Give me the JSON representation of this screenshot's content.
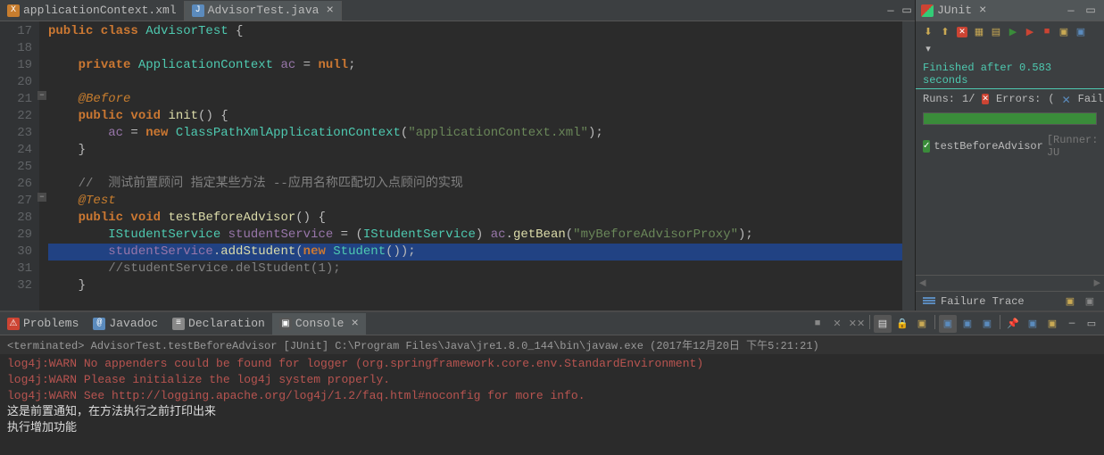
{
  "editor": {
    "tabs": [
      {
        "label": "applicationContext.xml",
        "type": "x"
      },
      {
        "label": "AdvisorTest.java",
        "type": "j"
      }
    ],
    "activeTab": 1,
    "lines": [
      {
        "n": "17",
        "t": [
          {
            "c": "kw",
            "v": "public class "
          },
          {
            "c": "clsname",
            "v": "AdvisorTest"
          },
          {
            "c": "",
            "v": " {"
          }
        ]
      },
      {
        "n": "18",
        "t": []
      },
      {
        "n": "19",
        "t": [
          {
            "c": "",
            "v": "    "
          },
          {
            "c": "kw",
            "v": "private "
          },
          {
            "c": "clsname",
            "v": "ApplicationContext"
          },
          {
            "c": "",
            "v": " "
          },
          {
            "c": "fld",
            "v": "ac"
          },
          {
            "c": "",
            "v": " = "
          },
          {
            "c": "kw",
            "v": "null"
          },
          {
            "c": "",
            "v": ";"
          }
        ]
      },
      {
        "n": "20",
        "t": []
      },
      {
        "n": "21",
        "fold": true,
        "t": [
          {
            "c": "",
            "v": "    "
          },
          {
            "c": "anno",
            "v": "@Before"
          }
        ]
      },
      {
        "n": "22",
        "t": [
          {
            "c": "",
            "v": "    "
          },
          {
            "c": "kw",
            "v": "public void "
          },
          {
            "c": "fn",
            "v": "init"
          },
          {
            "c": "",
            "v": "() {"
          }
        ]
      },
      {
        "n": "23",
        "t": [
          {
            "c": "",
            "v": "        "
          },
          {
            "c": "fld",
            "v": "ac"
          },
          {
            "c": "",
            "v": " = "
          },
          {
            "c": "kw",
            "v": "new "
          },
          {
            "c": "clsname",
            "v": "ClassPathXmlApplicationContext"
          },
          {
            "c": "",
            "v": "("
          },
          {
            "c": "str",
            "v": "\"applicationContext.xml\""
          },
          {
            "c": "",
            "v": ");"
          }
        ]
      },
      {
        "n": "24",
        "t": [
          {
            "c": "",
            "v": "    }"
          }
        ]
      },
      {
        "n": "25",
        "t": []
      },
      {
        "n": "26",
        "t": [
          {
            "c": "",
            "v": "    "
          },
          {
            "c": "cmt",
            "v": "//  测试前置顾问 指定某些方法 --应用名称匹配切入点顾问的实现"
          }
        ]
      },
      {
        "n": "27",
        "fold": true,
        "t": [
          {
            "c": "",
            "v": "    "
          },
          {
            "c": "anno",
            "v": "@Test"
          }
        ]
      },
      {
        "n": "28",
        "t": [
          {
            "c": "",
            "v": "    "
          },
          {
            "c": "kw",
            "v": "public void "
          },
          {
            "c": "fn",
            "v": "testBeforeAdvisor"
          },
          {
            "c": "",
            "v": "() {"
          }
        ]
      },
      {
        "n": "29",
        "t": [
          {
            "c": "",
            "v": "        "
          },
          {
            "c": "clsname",
            "v": "IStudentService"
          },
          {
            "c": "",
            "v": " "
          },
          {
            "c": "fld",
            "v": "studentService"
          },
          {
            "c": "",
            "v": " = ("
          },
          {
            "c": "clsname",
            "v": "IStudentService"
          },
          {
            "c": "",
            "v": ") "
          },
          {
            "c": "fld",
            "v": "ac"
          },
          {
            "c": "",
            "v": "."
          },
          {
            "c": "fn",
            "v": "getBean"
          },
          {
            "c": "",
            "v": "("
          },
          {
            "c": "str",
            "v": "\"myBeforeAdvisorProxy\""
          },
          {
            "c": "",
            "v": ");"
          }
        ]
      },
      {
        "n": "30",
        "hl": true,
        "t": [
          {
            "c": "",
            "v": "        "
          },
          {
            "c": "fld",
            "v": "studentService"
          },
          {
            "c": "",
            "v": "."
          },
          {
            "c": "fn",
            "v": "addStudent"
          },
          {
            "c": "",
            "v": "("
          },
          {
            "c": "kw",
            "v": "new "
          },
          {
            "c": "clsname",
            "v": "Student"
          },
          {
            "c": "",
            "v": "());"
          }
        ]
      },
      {
        "n": "31",
        "t": [
          {
            "c": "",
            "v": "        "
          },
          {
            "c": "cmt",
            "v": "//studentService.delStudent(1);"
          }
        ]
      },
      {
        "n": "32",
        "t": [
          {
            "c": "",
            "v": "    }"
          }
        ]
      }
    ]
  },
  "junit": {
    "title": "JUnit",
    "status": "Finished after 0.583 seconds",
    "stats": {
      "runs_label": "Runs:",
      "runs": "1/",
      "errors_label": "Errors:",
      "failures_label": "Failures:",
      "err_count": "(",
      "fail_count": "("
    },
    "tree": [
      {
        "name": "testBeforeAdvisor",
        "runner": "[Runner: JU"
      }
    ],
    "failure_trace_label": "Failure Trace"
  },
  "bottomTabs": [
    {
      "label": "Problems",
      "ico": "⚠",
      "bg": "#c43"
    },
    {
      "label": "Javadoc",
      "ico": "@",
      "bg": "#5b8bbd"
    },
    {
      "label": "Declaration",
      "ico": "≡",
      "bg": "#888"
    },
    {
      "label": "Console",
      "ico": "▣",
      "bg": "#555"
    }
  ],
  "activeBottomTab": 3,
  "console": {
    "header": "<terminated> AdvisorTest.testBeforeAdvisor [JUnit] C:\\Program Files\\Java\\jre1.8.0_144\\bin\\javaw.exe (2017年12月20日 下午5:21:21)",
    "lines": [
      {
        "c": "warn",
        "v": "log4j:WARN No appenders could be found for logger (org.springframework.core.env.StandardEnvironment)"
      },
      {
        "c": "warn",
        "v": "log4j:WARN Please initialize the log4j system properly."
      },
      {
        "c": "warn",
        "v": "log4j:WARN See http://logging.apache.org/log4j/1.2/faq.html#noconfig for more info."
      },
      {
        "c": "info",
        "v": "这是前置通知，在方法执行之前打印出来"
      },
      {
        "c": "info",
        "v": "执行增加功能"
      }
    ]
  }
}
